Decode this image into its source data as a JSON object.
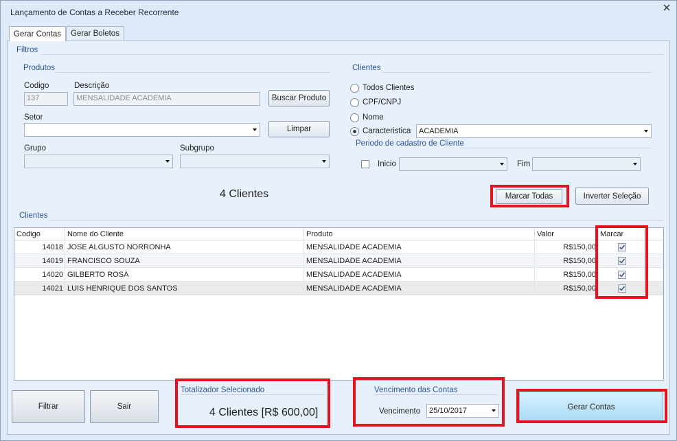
{
  "window": {
    "title": "Lançamento de Contas a Receber Recorrente"
  },
  "tabs": [
    {
      "label": "Gerar Contas",
      "active": true
    },
    {
      "label": "Gerar Boletos",
      "active": false
    }
  ],
  "filtros": {
    "title": "Filtros",
    "produtos": {
      "title": "Produtos",
      "codigo_label": "Codigo",
      "codigo_value": "137",
      "descricao_label": "Descrição",
      "descricao_value": "MENSALIDADE ACADEMIA",
      "buscar_button": "Buscar Produto",
      "setor_label": "Setor",
      "setor_value": "",
      "limpar_button": "Limpar",
      "grupo_label": "Grupo",
      "grupo_value": "",
      "subgrupo_label": "Subgrupo",
      "subgrupo_value": ""
    },
    "clientes": {
      "title": "Clientes",
      "options": [
        {
          "label": "Todos Clientes",
          "checked": false
        },
        {
          "label": "CPF/CNPJ",
          "checked": false
        },
        {
          "label": "Nome",
          "checked": false
        },
        {
          "label": "Caracteristica",
          "checked": true
        }
      ],
      "caracteristica_value": "ACADEMIA",
      "periodo_title": "Periodo de cadastro de Cliente",
      "inicio_label": "Inicio",
      "inicio_value": "",
      "fim_label": "Fim",
      "fim_value": ""
    },
    "count_text": "4 Clientes",
    "marcar_todas_button": "Marcar Todas",
    "inverter_button": "Inverter Seleção"
  },
  "clientes_grid": {
    "title": "Clientes",
    "columns": [
      "Codigo",
      "Nome do Cliente",
      "Produto",
      "Valor",
      "Marcar"
    ],
    "rows": [
      {
        "codigo": "14018",
        "nome": "JOSE ALGUSTO NORRONHA",
        "produto": "MENSALIDADE ACADEMIA",
        "valor": "R$150,00",
        "marcar": true
      },
      {
        "codigo": "14019",
        "nome": "FRANCISCO SOUZA",
        "produto": "MENSALIDADE ACADEMIA",
        "valor": "R$150,00",
        "marcar": true
      },
      {
        "codigo": "14020",
        "nome": "GILBERTO ROSA",
        "produto": "MENSALIDADE ACADEMIA",
        "valor": "R$150,00",
        "marcar": true
      },
      {
        "codigo": "14021",
        "nome": "LUIS HENRIQUE DOS SANTOS",
        "produto": "MENSALIDADE ACADEMIA",
        "valor": "R$150,00",
        "marcar": true
      }
    ]
  },
  "footer": {
    "filtrar_button": "Filtrar",
    "sair_button": "Sair",
    "totalizador_title": "Totalizador Selecionado",
    "totalizador_value": "4 Clientes [R$ 600,00]",
    "vencimento_title": "Vencimento das Contas",
    "vencimento_label": "Vencimento",
    "vencimento_value": "25/10/2017",
    "gerar_button": "Gerar Contas"
  },
  "colors": {
    "highlight": "#e3141e",
    "group_title": "#2b5797"
  }
}
